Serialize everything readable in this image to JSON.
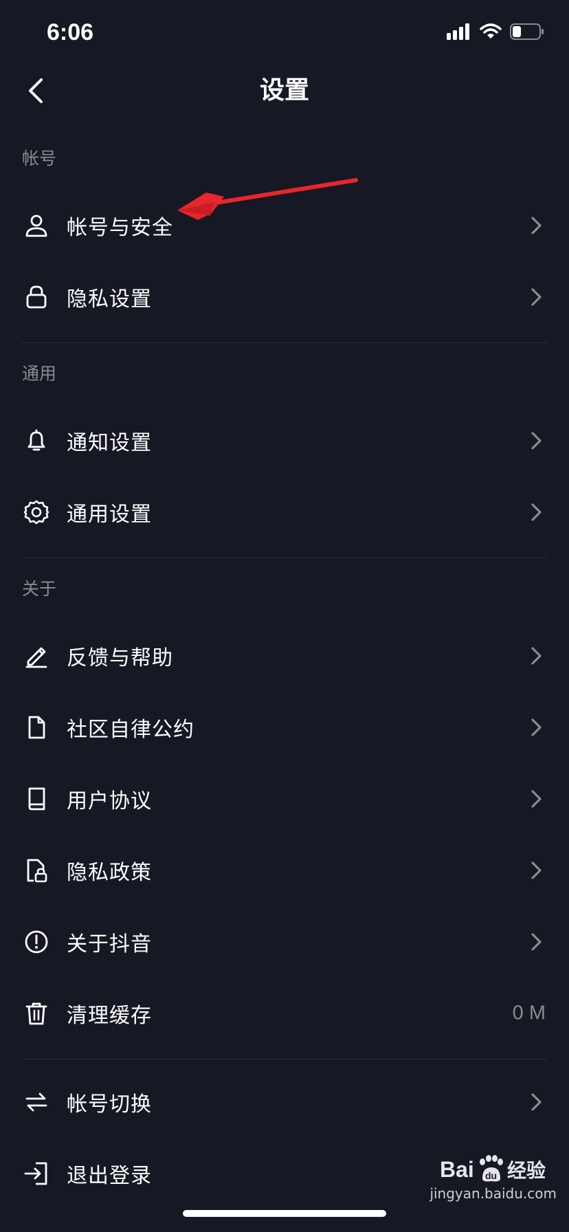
{
  "status": {
    "time": "6:06"
  },
  "header": {
    "title": "设置"
  },
  "sections": [
    {
      "title": "帐号",
      "items": [
        {
          "label": "帐号与安全",
          "icon": "user-icon"
        },
        {
          "label": "隐私设置",
          "icon": "lock-icon"
        }
      ]
    },
    {
      "title": "通用",
      "items": [
        {
          "label": "通知设置",
          "icon": "bell-icon"
        },
        {
          "label": "通用设置",
          "icon": "gear-icon"
        }
      ]
    },
    {
      "title": "关于",
      "items": [
        {
          "label": "反馈与帮助",
          "icon": "pencil-icon"
        },
        {
          "label": "社区自律公约",
          "icon": "document-icon"
        },
        {
          "label": "用户协议",
          "icon": "book-icon"
        },
        {
          "label": "隐私政策",
          "icon": "file-lock-icon"
        },
        {
          "label": "关于抖音",
          "icon": "info-circle-icon"
        },
        {
          "label": "清理缓存",
          "icon": "trash-icon",
          "value": "0 M"
        }
      ]
    },
    {
      "title": "",
      "items": [
        {
          "label": "帐号切换",
          "icon": "swap-icon"
        },
        {
          "label": "退出登录",
          "icon": "logout-icon"
        }
      ]
    }
  ],
  "watermark": {
    "logo_text": "Bai du 经验",
    "url": "jingyan.baidu.com"
  },
  "colors": {
    "background": "#161823",
    "text": "#ffffff",
    "muted": "#8a8b91",
    "divider": "#2b2c35",
    "annotation": "#e8262b"
  }
}
